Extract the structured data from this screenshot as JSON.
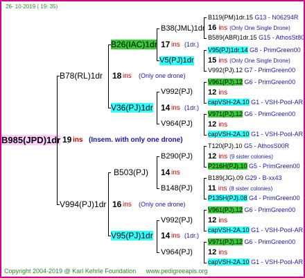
{
  "header": {
    "date": "26- 10-2019 ( 19: 35)"
  },
  "root": {
    "name": "B985(JPD)1dr",
    "num": "19",
    "ins": "ins",
    "note": "(Insem. with only one drone)"
  },
  "gen1": [
    {
      "name": "B78(RL)1dr",
      "num": "18",
      "ins": "ins",
      "note": "(Only one drone)"
    },
    {
      "name": "V994(PJ)1dr",
      "num": "16",
      "ins": "ins",
      "note": "(Only one drone)"
    }
  ],
  "gen2": [
    {
      "name": "B26(IAC)1dr",
      "num": "17",
      "ins": "ins",
      "note": "(1dr.)"
    },
    {
      "name": "V36(PJ)1dr",
      "num": "14",
      "ins": "ins",
      "note": "(1dr.)"
    },
    {
      "name": "B503(PJ)",
      "num": "14",
      "ins": "ins"
    },
    {
      "name": "V95(PJ)1dr",
      "num": "14",
      "ins": "ins",
      "note": "(1dr.)"
    }
  ],
  "gen3": [
    {
      "name": "B38(JML)1dr",
      "num": "16",
      "ins": "ins",
      "note": "(Only One Single Drone)"
    },
    {
      "name": "V5(PJ)1dr",
      "num": "15",
      "ins": "ins",
      "note": "(Only One Single Drone)"
    },
    {
      "name": "V992(PJ)",
      "num": "12",
      "ins": "ins"
    },
    {
      "name": "V964(PJ)",
      "num": "12",
      "ins": "ins"
    },
    {
      "name": "B290(PJ)",
      "num": "12",
      "ins": "ins",
      "note": "(9 sister colonies)"
    },
    {
      "name": "B148(PJ)",
      "num": "11",
      "ins": "ins",
      "note": "(8 sister colonies)"
    },
    {
      "name": "V992(PJ)",
      "num": "12",
      "ins": "ins"
    },
    {
      "name": "V964(PJ)",
      "num": "12",
      "ins": "ins"
    }
  ],
  "gen4": [
    {
      "name": "B119(PM)1dr.15",
      "tag": "G13 - N06294R"
    },
    {
      "name": "B589(ABR)1dr.15",
      "tag": "G15 - AthosSt80R"
    },
    {
      "name": "V95(PJ)1dr.14",
      "tag": "G8 - PrimGreen00"
    },
    {
      "name": "V992(PJ).12",
      "tag": "G7 - PrimGreen00"
    },
    {
      "name": "V961(PJ).12",
      "tag": "G6 - PrimGreen00"
    },
    {
      "name": "capVSH-2A.10",
      "tag": "G1 - VSH-Pool-AR"
    },
    {
      "name": "V971(PJ).12",
      "tag": "G6 - PrimGreen00"
    },
    {
      "name": "capVSH-2A.10",
      "tag": "G1 - VSH-Pool-AR"
    },
    {
      "name": "T120(PJ).10",
      "tag": "G5 - AthosS00R"
    },
    {
      "name": "P216H(PJ).10",
      "tag": "G5 - PrimGreen00"
    },
    {
      "name": "B189(JG).09",
      "tag": "G29 - B-xx43"
    },
    {
      "name": "P135H(PJ).08",
      "tag": "G4 - PrimGreen00"
    },
    {
      "name": "V961(PJ).12",
      "tag": "G6 - PrimGreen00"
    },
    {
      "name": "capVSH-2A.10",
      "tag": "G1 - VSH-Pool-AR"
    },
    {
      "name": "V971(PJ).12",
      "tag": "G6 - PrimGreen00"
    },
    {
      "name": "capVSH-2A.10",
      "tag": "G1 - VSH-Pool-AR"
    }
  ],
  "footer": {
    "copyright": "Copyright 2004-2019 @ Karl Kehrle Foundation",
    "site": "www.pedigreeapis.org"
  },
  "colors": {
    "border": "#d2008c",
    "green": "#33cc33",
    "cyan": "#33ffff",
    "pink": "#ffccff",
    "ins": "#cc0000",
    "note": "#1a1aa6"
  }
}
